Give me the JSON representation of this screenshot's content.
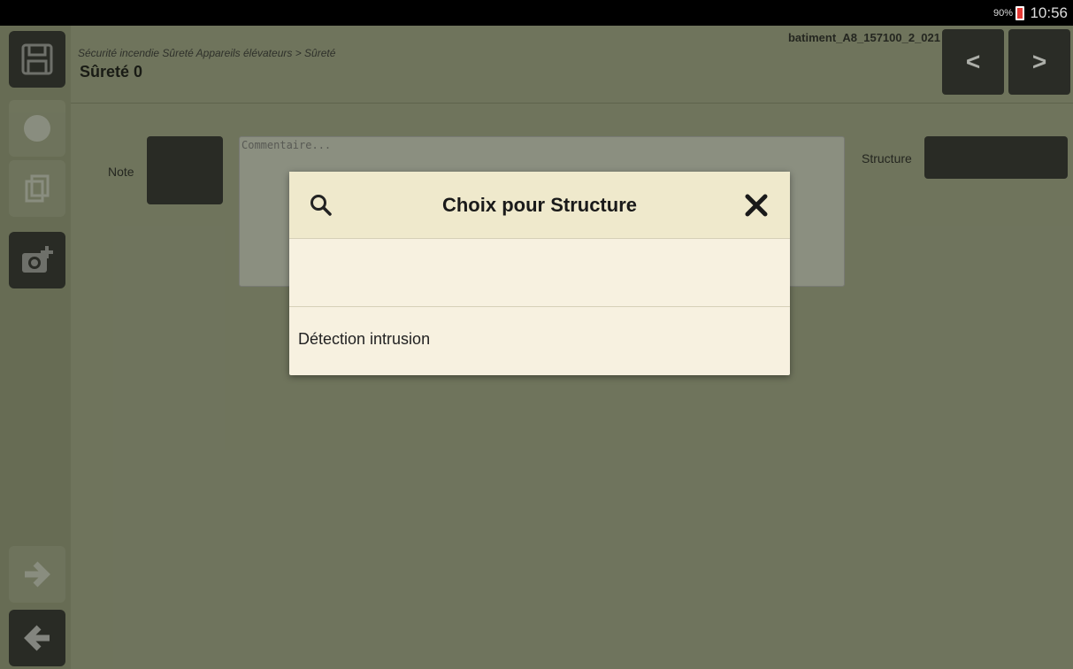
{
  "status": {
    "battery": "90%",
    "time": "10:56"
  },
  "header": {
    "breadcrumb": "Sécurité incendie Sûreté Appareils élévateurs > Sûreté",
    "title": "Sûreté 0",
    "building_id": "batiment_A8_157100_2_021",
    "prev_label": "<",
    "next_label": ">"
  },
  "sidebar": {
    "icons": [
      "save-icon",
      "globe-icon",
      "copy-icon",
      "add-photo-icon",
      "forward-arrow-icon",
      "back-arrow-icon"
    ]
  },
  "form": {
    "note_label": "Note",
    "comment_placeholder": "Commentaire...",
    "structure_label": "Structure"
  },
  "dialog": {
    "title": "Choix pour Structure",
    "options": [
      "",
      "Détection intrusion"
    ]
  },
  "colors": {
    "overlay": "#5c6150",
    "dialog_bg": "#f7f1e0",
    "dialog_header": "#efe9cc"
  }
}
